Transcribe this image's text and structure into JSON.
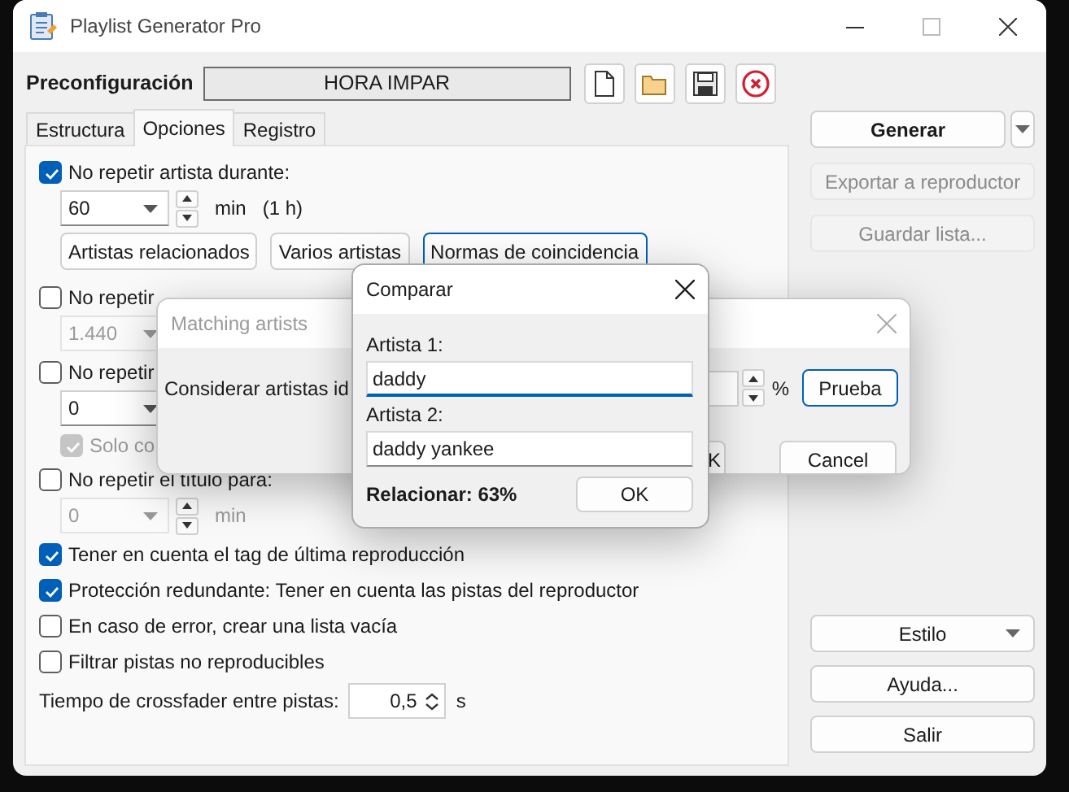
{
  "window": {
    "title": "Playlist Generator Pro"
  },
  "preset": {
    "label": "Preconfiguración",
    "value": "HORA IMPAR"
  },
  "tabs": [
    {
      "label": "Estructura",
      "selected": false
    },
    {
      "label": "Opciones",
      "selected": true
    },
    {
      "label": "Registro",
      "selected": false
    }
  ],
  "options": [
    {
      "kind": "check",
      "label": "No repetir artista durante:",
      "checked": true,
      "disabled": false
    },
    {
      "kind": "combo",
      "value": "60",
      "unit": "min",
      "note": "(1 h)",
      "disabled": false
    },
    {
      "kind": "buttons",
      "buttons": [
        {
          "label": "Artistas relacionados",
          "focused": false
        },
        {
          "label": "Varios artistas",
          "focused": false
        },
        {
          "label": "Normas de coincidencia",
          "focused": true
        }
      ]
    },
    {
      "kind": "check",
      "label": "No repetir",
      "checked": false,
      "disabled": false
    },
    {
      "kind": "combo",
      "value": "1.440",
      "disabled": true
    },
    {
      "kind": "check",
      "label": "No repetir",
      "checked": false,
      "disabled": false
    },
    {
      "kind": "combo",
      "value": "0",
      "disabled": false
    },
    {
      "kind": "subcheck",
      "label": "Solo co",
      "checked": true,
      "disabled": true
    },
    {
      "kind": "check",
      "label": "No repetir el título para:",
      "checked": false,
      "disabled": false
    },
    {
      "kind": "combo",
      "value": "0",
      "unit": "min",
      "disabled": true
    },
    {
      "kind": "check",
      "label": "Tener en cuenta el tag de última reproducción",
      "checked": true,
      "disabled": false
    },
    {
      "kind": "check",
      "label": "Protección redundante: Tener en cuenta las pistas del reproductor",
      "checked": true,
      "disabled": false
    },
    {
      "kind": "check",
      "label": "En caso de error, crear una lista vacía",
      "checked": false,
      "disabled": false
    },
    {
      "kind": "check",
      "label": "Filtrar pistas no reproducibles",
      "checked": false,
      "disabled": false
    },
    {
      "kind": "spin",
      "label": "Tiempo de crossfader entre pistas:",
      "value": "0,5",
      "unit": "s"
    }
  ],
  "actions_top": [
    {
      "kind": "split",
      "label": "Generar",
      "disabled": false
    },
    {
      "kind": "button",
      "label": "Exportar a reproductor",
      "disabled": true
    },
    {
      "kind": "button",
      "label": "Guardar lista...",
      "disabled": true
    }
  ],
  "actions_bottom": [
    {
      "kind": "dropdown",
      "label": "Estilo",
      "disabled": false
    },
    {
      "kind": "button",
      "label": "Ayuda...",
      "disabled": false
    },
    {
      "kind": "button",
      "label": "Salir",
      "disabled": false
    }
  ],
  "matching_dialog": {
    "title": "Matching artists",
    "active": false,
    "label": "Considerar artistas id",
    "unit": "%",
    "test_button": "Prueba",
    "ok_button": "K",
    "cancel_button": "Cancel"
  },
  "compare_dialog": {
    "title": "Comparar",
    "active": true,
    "fields": [
      {
        "label": "Artista 1:",
        "value": "daddy",
        "focused": true
      },
      {
        "label": "Artista 2:",
        "value": "daddy yankee",
        "focused": false
      }
    ],
    "result": "Relacionar: 63%",
    "ok_button": "OK"
  }
}
